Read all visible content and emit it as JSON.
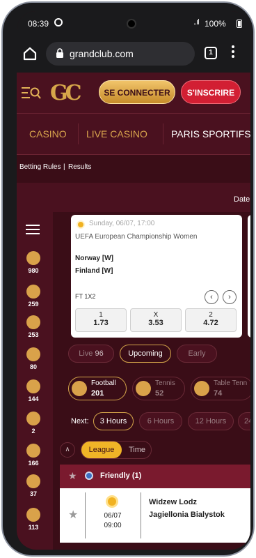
{
  "status_bar": {
    "time": "08:39",
    "signal": "..ıl",
    "battery": "100%"
  },
  "browser": {
    "url": "grandclub.com",
    "tab_count": "1"
  },
  "header": {
    "logo": "GC",
    "login_label": "SE CONNECTER",
    "signup_label": "S'INSCRIRE"
  },
  "nav": {
    "casino": "CASINO",
    "live_casino": "LIVE CASINO",
    "sports": "PARIS SPORTIFS"
  },
  "sub_links": {
    "rules": "Betting Rules",
    "separator": "|",
    "results": "Results"
  },
  "date_label": "Date",
  "rail": {
    "items": [
      {
        "icon": "football-icon",
        "count": "980"
      },
      {
        "icon": "tennis-icon",
        "count": "259"
      },
      {
        "icon": "table-tennis-icon",
        "count": "253"
      },
      {
        "icon": "basketball-icon",
        "count": "80"
      },
      {
        "icon": "american-football-icon",
        "count": "144"
      },
      {
        "icon": "rugby-icon",
        "count": "2"
      },
      {
        "icon": "volleyball-icon",
        "count": "166"
      },
      {
        "icon": "baseball-icon",
        "count": "37"
      },
      {
        "icon": "esports-icon",
        "count": "113"
      }
    ]
  },
  "featured": {
    "datetime": "Sunday, 06/07, 17:00",
    "league": "UEFA European Championship Women",
    "team_home": "Norway [W]",
    "team_away": "Finland [W]",
    "market": "FT 1X2",
    "odds": [
      {
        "label": "1",
        "value": "1.73"
      },
      {
        "label": "X",
        "value": "3.53"
      },
      {
        "label": "2",
        "value": "4.72"
      }
    ]
  },
  "filters": {
    "live_label": "Live",
    "live_count": "96",
    "upcoming_label": "Upcoming",
    "early_label": "Early"
  },
  "sport_tabs": [
    {
      "name": "Football",
      "count": "201"
    },
    {
      "name": "Tennis",
      "count": "52"
    },
    {
      "name": "Table Tenn",
      "count": "74"
    }
  ],
  "next": {
    "label": "Next:",
    "options": [
      "3 Hours",
      "6 Hours",
      "12 Hours",
      "24"
    ]
  },
  "view_toggle": {
    "league": "League",
    "time": "Time"
  },
  "league_group": {
    "name": "Friendly (1)"
  },
  "match": {
    "date": "06/07",
    "time": "09:00",
    "team_home": "Widzew Lodz",
    "team_away": "Jagiellonia Bialystok"
  },
  "colors": {
    "brand_dark": "#3a0d17",
    "brand_mid": "#4a111f",
    "gold": "#d6a64a",
    "red": "#d21f33"
  }
}
